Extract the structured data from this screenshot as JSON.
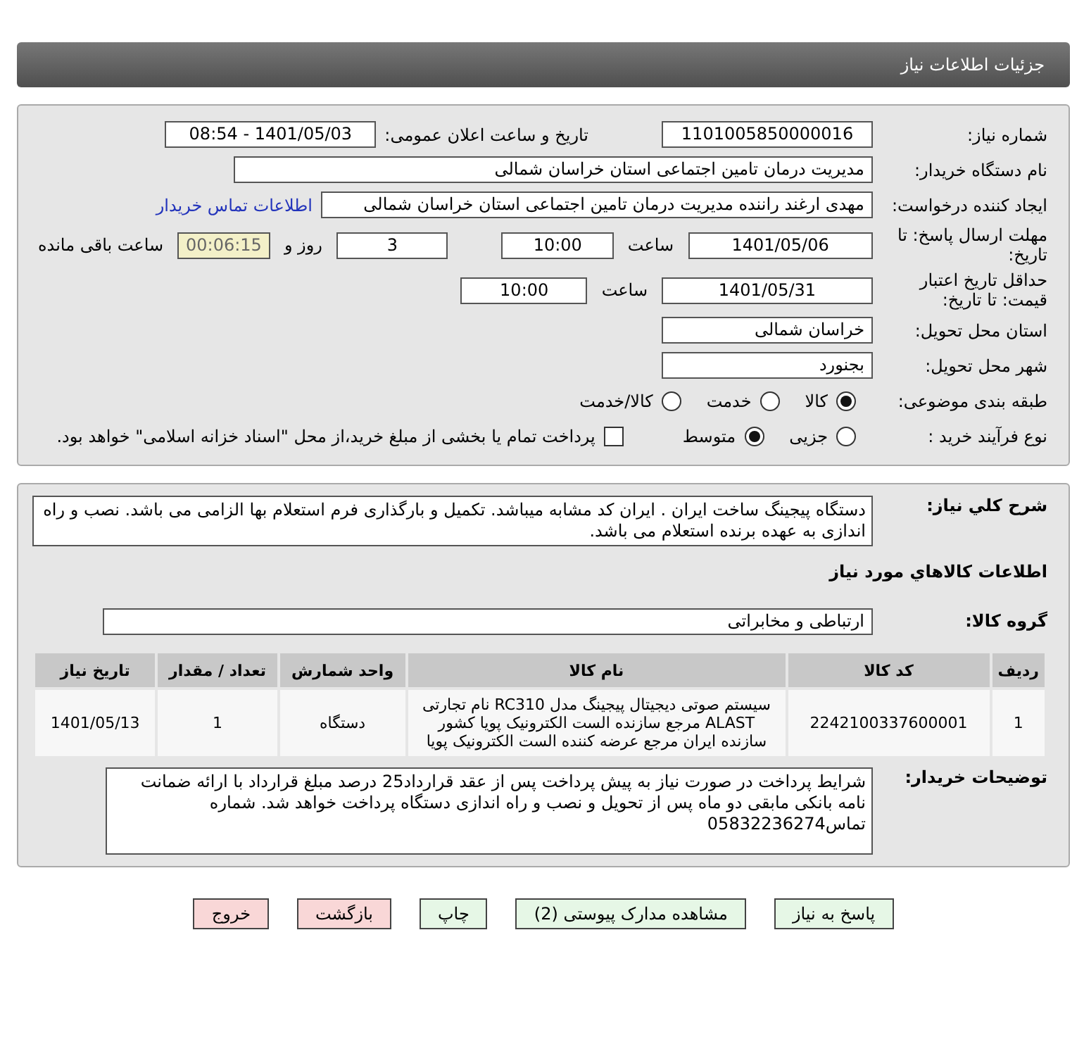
{
  "header": {
    "title": "جزئیات اطلاعات نیاز"
  },
  "need_number": {
    "label": "شماره نیاز:",
    "value": "1101005850000016"
  },
  "announce": {
    "label": "تاریخ و ساعت اعلان عمومی:",
    "value": "1401/05/03 - 08:54"
  },
  "buyer": {
    "label": "نام دستگاه خریدار:",
    "value": "مدیریت درمان تامین اجتماعی استان خراسان شمالی"
  },
  "creator": {
    "label": "ایجاد کننده درخواست:",
    "value": "مهدی ارغند راننده مدیریت درمان تامین اجتماعی استان خراسان شمالی",
    "link": "اطلاعات تماس خریدار"
  },
  "deadline": {
    "label": "مهلت ارسال پاسخ: تا تاریخ:",
    "date": "1401/05/06",
    "time_label": "ساعت",
    "time": "10:00",
    "days": "3",
    "days_label": "روز و",
    "remaining": "00:06:15",
    "remaining_label": "ساعت باقی مانده"
  },
  "validity": {
    "label": "حداقل تاریخ اعتبار قیمت: تا تاریخ:",
    "date": "1401/05/31",
    "time_label": "ساعت",
    "time": "10:00"
  },
  "province": {
    "label": "استان محل تحویل:",
    "value": "خراسان شمالی"
  },
  "city": {
    "label": "شهر محل تحویل:",
    "value": "بجنورد"
  },
  "category": {
    "label": "طبقه بندی موضوعی:",
    "options": [
      {
        "label": "کالا",
        "selected": true
      },
      {
        "label": "خدمت",
        "selected": false
      },
      {
        "label": "کالا/خدمت",
        "selected": false
      }
    ]
  },
  "process": {
    "label": "نوع فرآیند خرید :",
    "options": [
      {
        "label": "جزیی",
        "selected": false
      },
      {
        "label": "متوسط",
        "selected": true
      }
    ],
    "treasury": {
      "label": "پرداخت تمام یا بخشی از مبلغ خرید،از محل \"اسناد خزانه اسلامی\" خواهد بود.",
      "checked": false
    }
  },
  "description": {
    "label": "شرح کلي نياز:",
    "value": "دستگاه پیجینگ ساخت ایران . ایران کد مشابه میباشد. تکمیل و بارگذاری فرم استعلام بها الزامی می باشد. نصب و راه اندازی به عهده برنده استعلام می باشد."
  },
  "goods_title": "اطلاعات كالاهاي مورد نياز",
  "goods_group": {
    "label": "گروه کالا:",
    "value": "ارتباطی و مخابراتی"
  },
  "table": {
    "columns": [
      "ردیف",
      "کد کالا",
      "نام کالا",
      "واحد شمارش",
      "تعداد / مقدار",
      "تاریخ نیاز"
    ],
    "rows": [
      [
        "1",
        "2242100337600001",
        "سیستم صوتی دیجیتال پیجینگ مدل RC310 نام تجارتی ALAST مرجع سازنده الست الکترونیک پویا کشور سازنده ایران مرجع عرضه کننده الست الکترونیک پویا",
        "دستگاه",
        "1",
        "1401/05/13"
      ]
    ]
  },
  "notes": {
    "label": "توضیحات خریدار:",
    "value": "شرایط پرداخت در صورت نیاز به پیش پرداخت پس از عقد قرارداد25 درصد مبلغ قرارداد با ارائه ضمانت نامه بانکی مابقی دو ماه پس از تحویل و نصب و راه اندازی دستگاه پرداخت خواهد شد. شماره تماس05832236274"
  },
  "buttons": [
    {
      "label": "پاسخ به نیاز",
      "kind": "green"
    },
    {
      "label": "مشاهده مدارک پیوستی (2)",
      "kind": "green"
    },
    {
      "label": "چاپ",
      "kind": "green"
    },
    {
      "label": "بازگشت",
      "kind": "red"
    },
    {
      "label": "خروج",
      "kind": "red"
    }
  ]
}
